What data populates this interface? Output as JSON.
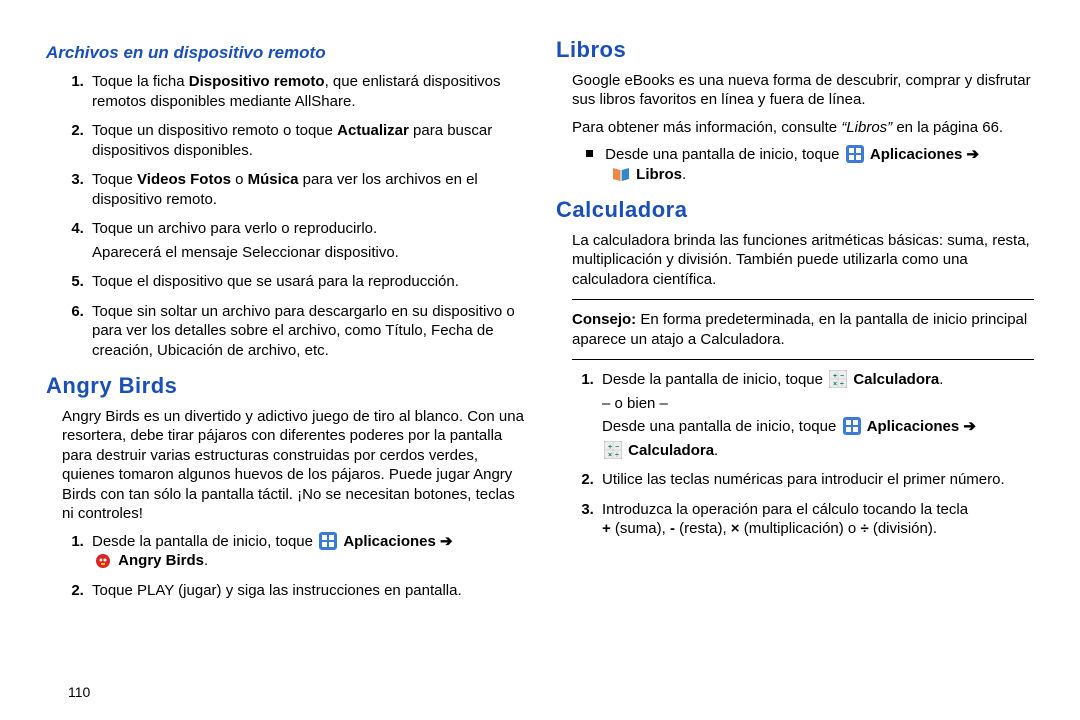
{
  "left": {
    "archivos": {
      "heading": "Archivos en un dispositivo remoto",
      "steps": [
        {
          "pre": "Toque la ficha ",
          "bold1": "Dispositivo remoto",
          "post1": ", que enlistará dispositivos remotos disponibles mediante AllShare."
        },
        {
          "pre": "Toque un dispositivo remoto o toque ",
          "bold1": "Actualizar",
          "post1": " para buscar dispositivos disponibles."
        },
        {
          "pre": "Toque ",
          "bold1": "Videos Fotos",
          "mid": " o ",
          "bold2": "Música",
          "post2": " para ver los archivos en el dispositivo remoto."
        },
        {
          "plain": "Toque un archivo para verlo o reproducirlo.",
          "after": "Aparecerá el mensaje Seleccionar dispositivo."
        },
        {
          "plain": "Toque el dispositivo que se usará para la reproducción."
        },
        {
          "plain": "Toque sin soltar un archivo para descargarlo en su dispositivo o para ver los detalles sobre el archivo, como Título, Fecha de creación, Ubicación de archivo, etc."
        }
      ]
    },
    "angrybirds": {
      "heading": "Angry Birds",
      "para": "Angry Birds es un divertido y adictivo juego de tiro al blanco. Con una resortera, debe tirar pájaros con diferentes poderes por la pantalla para destruir varias estructuras construidas por cerdos verdes, quienes tomaron algunos huevos de los pájaros. Puede jugar Angry Birds con tan sólo la pantalla táctil. ¡No se necesitan botones, teclas ni controles!",
      "step1_pre": "Desde la pantalla de inicio, toque ",
      "step1_apps": "Aplicaciones ➔",
      "step1_app": "Angry Birds",
      "step2": "Toque PLAY (jugar) y siga las instrucciones en pantalla."
    }
  },
  "right": {
    "libros": {
      "heading": "Libros",
      "para1": "Google eBooks es una nueva forma de descubrir, comprar y disfrutar sus libros favoritos en línea y fuera de línea.",
      "para2_pre": "Para obtener más información, consulte ",
      "para2_ref": "“Libros”",
      "para2_post": " en la página 66.",
      "bullet_pre": "Desde una pantalla de inicio, toque ",
      "bullet_apps": "Aplicaciones ➔",
      "bullet_app": "Libros"
    },
    "calc": {
      "heading": "Calculadora",
      "para": "La calculadora brinda las funciones aritméticas básicas: suma, resta, multiplicación y división. También puede utilizarla como una calculadora científica.",
      "tip_label": "Consejo:",
      "tip_text": " En forma predeterminada, en la pantalla de inicio principal aparece un atajo a Calculadora.",
      "step1_pre": "Desde la pantalla de inicio, toque ",
      "step1_app": "Calculadora",
      "step1_or": "– o bien –",
      "step1b_pre": "Desde una pantalla de inicio, toque ",
      "step1b_apps": "Aplicaciones ➔",
      "step1b_app": "Calculadora",
      "step2": "Utilice las teclas numéricas para introducir el primer número.",
      "step3_pre": "Introduzca la operación para el cálculo tocando la tecla ",
      "step3_ops": "+ (suma), - (resta), × (multiplicación) o ÷ (división)."
    }
  },
  "page_number": "110"
}
